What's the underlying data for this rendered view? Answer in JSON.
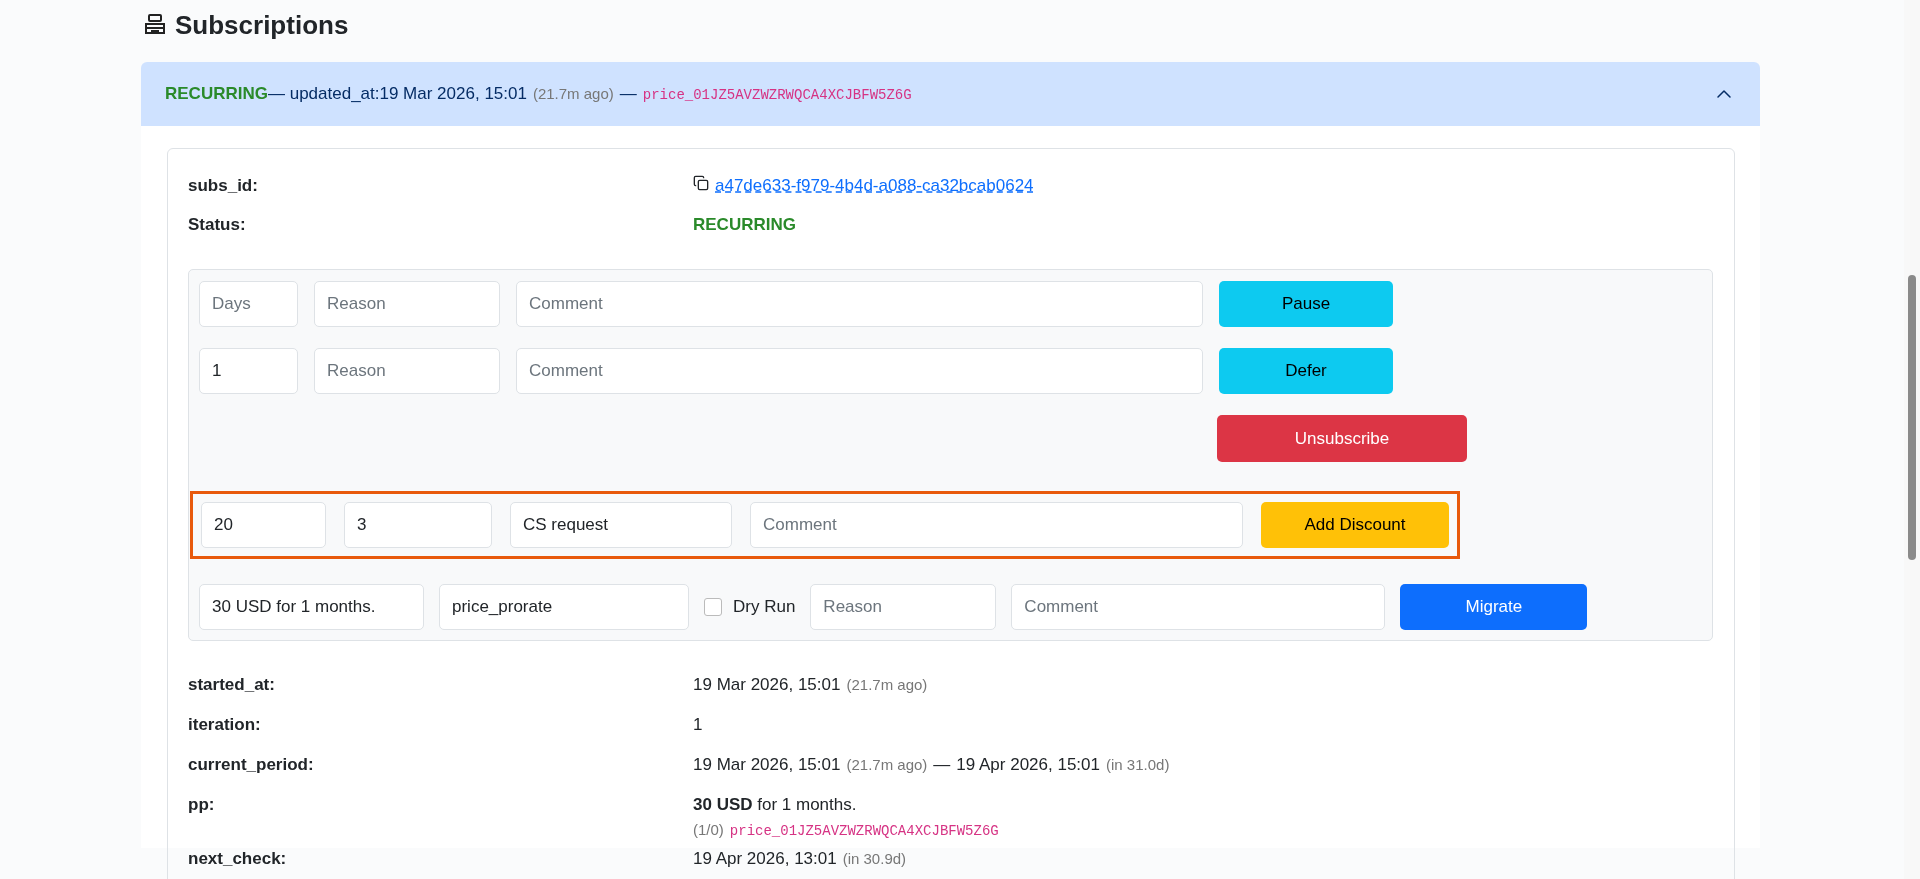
{
  "heading": {
    "title": "Subscriptions"
  },
  "accordion": {
    "expanded": true,
    "status": "RECURRING",
    "updated": "— updated_at:19 Mar 2026, 15:01",
    "ago": "(21.7m ago)",
    "separator": "—",
    "price_id": "price_01JZ5AVZWZRWQCA4XCJBFW5Z6G"
  },
  "summary": [
    {
      "kind": "link",
      "label": "subs_id:",
      "value": "a47de633-f979-4b4d-a088-ca32bcab0624"
    },
    {
      "kind": "status",
      "label": "Status:",
      "value": "RECURRING"
    }
  ],
  "actions": [
    {
      "kind": "pause",
      "highlighted": false,
      "items": [
        {
          "kind": "field",
          "placeholder": "Days"
        },
        {
          "kind": "field",
          "placeholder": "Reason"
        },
        {
          "kind": "field",
          "placeholder": "Comment"
        },
        {
          "kind": "button",
          "label": "Pause"
        }
      ]
    },
    {
      "kind": "defer",
      "highlighted": false,
      "items": [
        {
          "kind": "field",
          "value": "1"
        },
        {
          "kind": "field",
          "placeholder": "Reason"
        },
        {
          "kind": "field",
          "placeholder": "Comment"
        },
        {
          "kind": "button",
          "label": "Defer"
        }
      ]
    },
    {
      "kind": "unsubscribe",
      "highlighted": false,
      "items": [
        {
          "kind": "button",
          "label": "Unsubscribe"
        }
      ]
    },
    {
      "kind": "discount",
      "highlighted": true,
      "items": [
        {
          "kind": "field",
          "value": "20"
        },
        {
          "kind": "field",
          "value": "3"
        },
        {
          "kind": "field",
          "value": "CS request"
        },
        {
          "kind": "field",
          "placeholder": "Comment"
        },
        {
          "kind": "button",
          "label": "Add Discount"
        }
      ]
    },
    {
      "kind": "migrate",
      "highlighted": false,
      "items": [
        {
          "kind": "field",
          "value": "30 USD for 1 months."
        },
        {
          "kind": "field",
          "value": "price_prorate"
        },
        {
          "kind": "checkbox",
          "label": "Dry Run",
          "checked": false
        },
        {
          "kind": "field",
          "placeholder": "Reason"
        },
        {
          "kind": "field",
          "placeholder": "Comment"
        },
        {
          "kind": "button",
          "label": "Migrate"
        }
      ]
    }
  ],
  "details": [
    {
      "kind": "date",
      "label": "started_at:",
      "value": "19 Mar 2026, 15:01",
      "note": "(21.7m ago)"
    },
    {
      "kind": "plain",
      "label": "iteration:",
      "value": "1"
    },
    {
      "kind": "period",
      "label": "current_period:",
      "start": "19 Mar 2026, 15:01",
      "start_note": "(21.7m ago)",
      "separator": "—",
      "end": "19 Apr 2026, 15:01",
      "end_note": "(in 31.0d)"
    },
    {
      "kind": "price",
      "label": "pp:",
      "value": "**30 USD** for 1 months.",
      "count": "(1/0)",
      "price_id": "price_01JZ5AVZWZRWQCA4XCJBFW5Z6G"
    },
    {
      "kind": "date",
      "label": "next_check:",
      "value": "19 Apr 2026, 13:01",
      "note": "(in 30.9d)"
    }
  ]
}
